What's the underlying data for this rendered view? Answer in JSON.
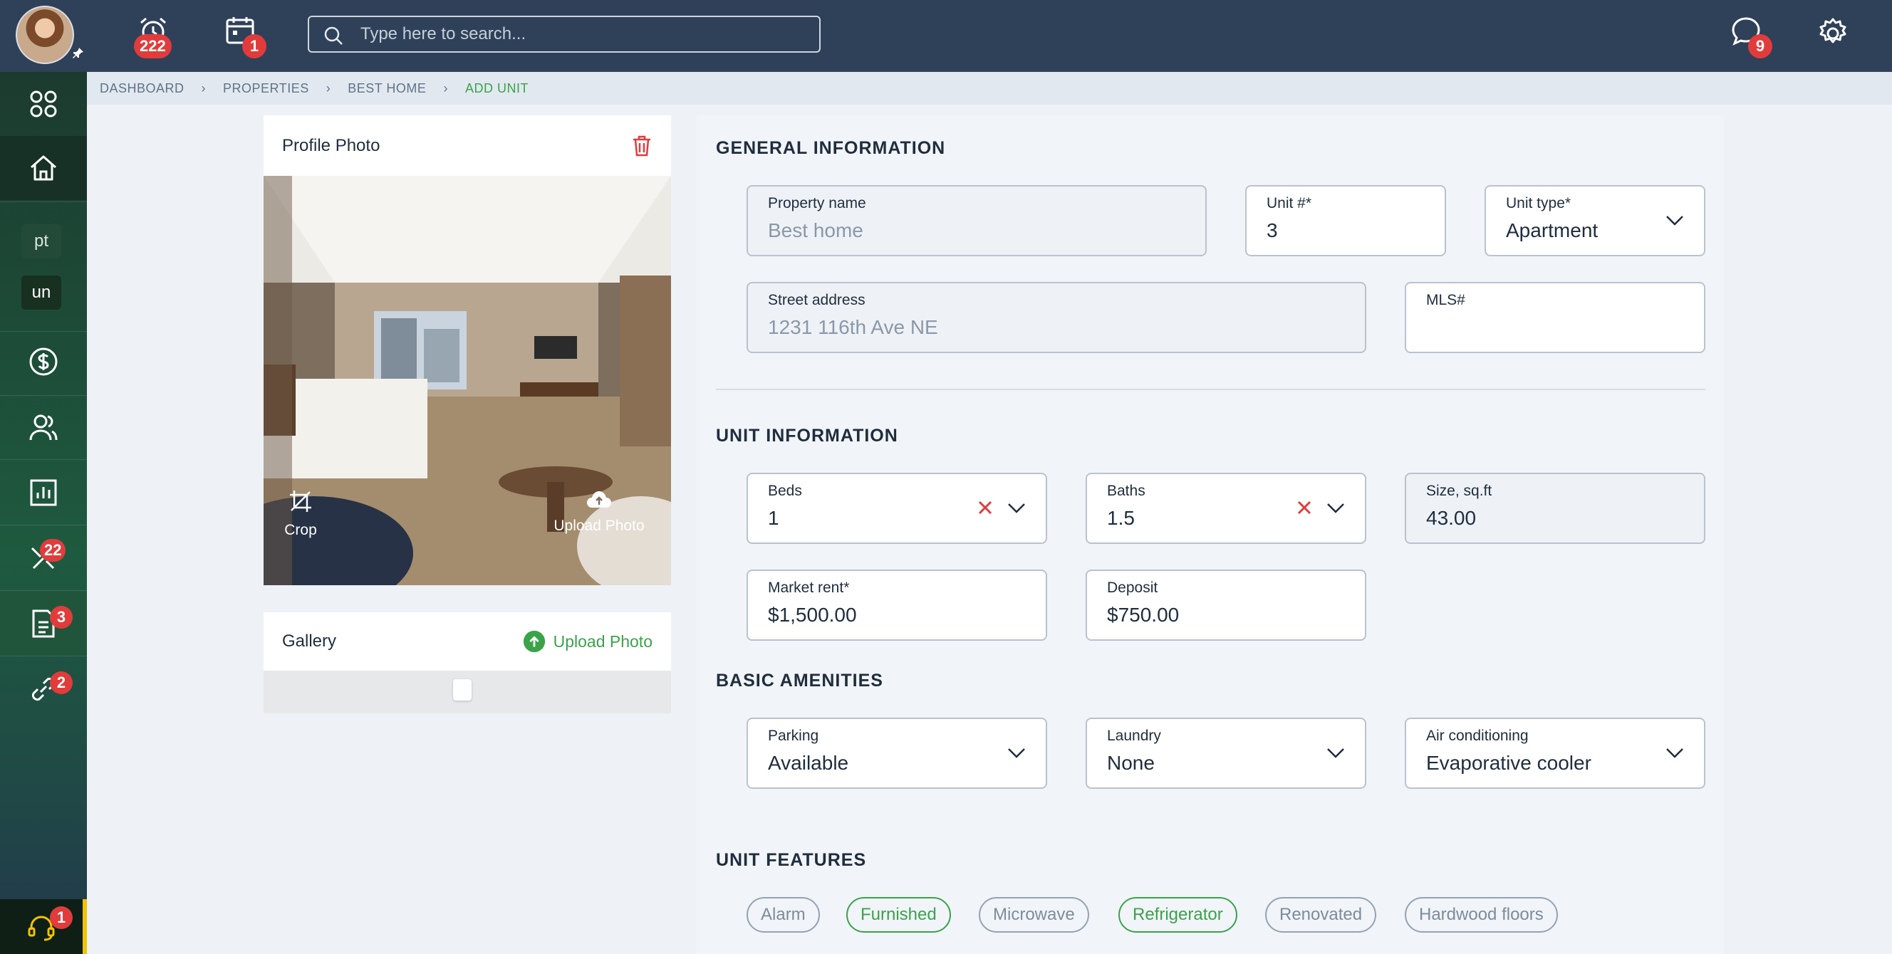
{
  "topbar": {
    "alerts_count": "222",
    "calendar_count": "1",
    "messages_count": "9",
    "search_placeholder": "Type here to search..."
  },
  "sidebar": {
    "chips": [
      "pt",
      "un"
    ],
    "maintenance_count": "22",
    "documents_count": "3",
    "links_count": "2",
    "support_count": "1"
  },
  "breadcrumb": [
    "DASHBOARD",
    "PROPERTIES",
    "BEST HOME",
    "ADD UNIT"
  ],
  "profile_photo": {
    "title": "Profile Photo",
    "crop_label": "Crop",
    "upload_label": "Upload Photo"
  },
  "gallery": {
    "title": "Gallery",
    "upload_label": "Upload Photo"
  },
  "general": {
    "title": "GENERAL INFORMATION",
    "property_name": {
      "label": "Property name",
      "value": "Best home"
    },
    "unit_number": {
      "label": "Unit #*",
      "value": "3"
    },
    "unit_type": {
      "label": "Unit type*",
      "value": "Apartment"
    },
    "street": {
      "label": "Street address",
      "value": "1231 116th Ave NE"
    },
    "mls": {
      "label": "MLS#",
      "value": ""
    }
  },
  "unit": {
    "title": "UNIT INFORMATION",
    "beds": {
      "label": "Beds",
      "value": "1"
    },
    "baths": {
      "label": "Baths",
      "value": "1.5"
    },
    "size": {
      "label": "Size, sq.ft",
      "value": "43.00"
    },
    "market_rent": {
      "label": "Market rent*",
      "value": "$1,500.00"
    },
    "deposit": {
      "label": "Deposit",
      "value": "$750.00"
    }
  },
  "amenities": {
    "title": "BASIC AMENITIES",
    "parking": {
      "label": "Parking",
      "value": "Available"
    },
    "laundry": {
      "label": "Laundry",
      "value": "None"
    },
    "air": {
      "label": "Air conditioning",
      "value": "Evaporative cooler"
    }
  },
  "features": {
    "title": "UNIT FEATURES",
    "tags": [
      {
        "label": "Alarm",
        "selected": false
      },
      {
        "label": "Furnished",
        "selected": true
      },
      {
        "label": "Microwave",
        "selected": false
      },
      {
        "label": "Refrigerator",
        "selected": true
      },
      {
        "label": "Renovated",
        "selected": false
      },
      {
        "label": "Hardwood floors",
        "selected": false
      }
    ]
  },
  "colors": {
    "accent": "#3aa34a",
    "danger": "#e23b3b",
    "topbar": "#2f4159"
  }
}
